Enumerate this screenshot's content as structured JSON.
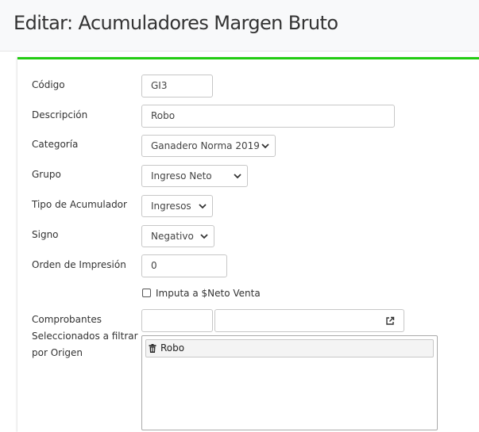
{
  "page": {
    "title": "Editar: Acumuladores Margen Bruto"
  },
  "form": {
    "codigo": {
      "label": "Código",
      "value": "GI3"
    },
    "descripcion": {
      "label": "Descripción",
      "value": "Robo"
    },
    "categoria": {
      "label": "Categoría",
      "value": "Ganadero Norma 2019"
    },
    "grupo": {
      "label": "Grupo",
      "value": "Ingreso Neto"
    },
    "tipo": {
      "label": "Tipo de Acumulador",
      "value": "Ingresos"
    },
    "signo": {
      "label": "Signo",
      "value": "Negativo"
    },
    "orden": {
      "label": "Orden de Impresión",
      "value": "0"
    },
    "imputa": {
      "label": "Imputa a $Neto Venta",
      "checked": false
    },
    "comprobantes": {
      "label_lines": [
        "Comprobantes",
        "Seleccionados a filtrar",
        "por Origen"
      ],
      "code_value": "",
      "name_value": "",
      "selected": [
        {
          "label": "Robo",
          "icon": "trash-icon"
        }
      ]
    }
  },
  "colors": {
    "accent": "#22cc11",
    "border": "#c7c7c7",
    "header_bg": "#f8f9fa"
  }
}
